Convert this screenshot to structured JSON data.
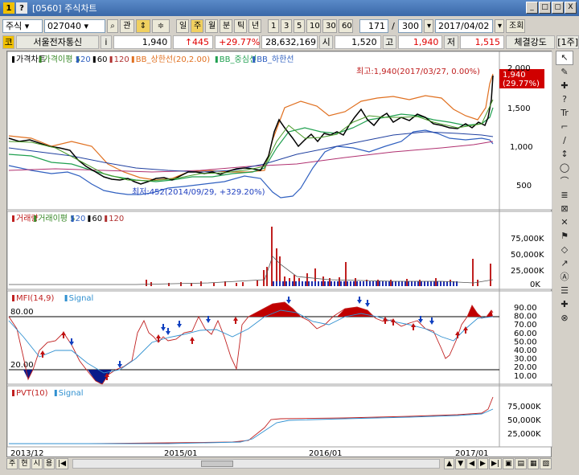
{
  "window": {
    "code_badge": "1",
    "help_badge": "?",
    "title": "[0560] 주식차트",
    "buttons": [
      "_",
      "□",
      "▢",
      "X"
    ]
  },
  "toolbar": {
    "market": "주식",
    "code": "027040",
    "btn_gwan": "관",
    "btn_updown": "≑",
    "periods": [
      "일",
      "주",
      "월",
      "분",
      "틱",
      "년"
    ],
    "active_period": 1,
    "intervals": [
      "1",
      "3",
      "5",
      "10",
      "30",
      "60"
    ],
    "count_value": "171",
    "slash": "/",
    "total_value": "300",
    "date": "2017/04/02",
    "btn_query": "조회"
  },
  "quote": {
    "badge": "코",
    "name": "서울전자통신",
    "info": "i",
    "price": "1,940",
    "change": "↑445",
    "rate": "+29.77%",
    "volume": "28,632,169",
    "open_label": "시",
    "open": "1,520",
    "high_label": "고",
    "high": "1,940",
    "low_label": "저",
    "low": "1,515",
    "strength_label": "체결강도",
    "view_btn": "[1주]"
  },
  "panels": {
    "price": {
      "legend": [
        "가격차트",
        "가격이평 5",
        "20",
        "60",
        "120",
        "BB_상한선(20,2.00)",
        "BB_중심선",
        "BB_하한선"
      ],
      "legend_colors": [
        "#000000",
        "#3a8a2a",
        "#3060c0",
        "#000000",
        "#b03030",
        "#e07020",
        "#20a050",
        "#3060c0"
      ],
      "axis": [
        "2,000",
        "1,500",
        "1,000",
        "500"
      ],
      "high_note": "최고:1,940(2017/03/27, 0.00%)",
      "low_note": "최저:452(2014/09/29, +329.20%)",
      "last_price": "1,940",
      "last_rate": "(29.77%)"
    },
    "volume": {
      "legend": [
        "거래량",
        "거래이평 5",
        "20",
        "60",
        "120"
      ],
      "legend_colors": [
        "#c02020",
        "#3a8a2a",
        "#3060c0",
        "#000000",
        "#b03030"
      ],
      "axis": [
        "75,000K",
        "50,000K",
        "25,000K",
        "0K"
      ]
    },
    "mfi": {
      "legend": [
        "MFI(14,9)",
        "Signal"
      ],
      "legend_colors": [
        "#c02020",
        "#3090d0"
      ],
      "axis": [
        "90.00",
        "80.00",
        "70.00",
        "60.00",
        "50.00",
        "40.00",
        "30.00",
        "20.00",
        "10.00"
      ],
      "upper": "80.00",
      "lower": "20.00"
    },
    "pvt": {
      "legend": [
        "PVT(10)",
        "Signal"
      ],
      "legend_colors": [
        "#c02020",
        "#3090d0"
      ],
      "axis": [
        "75,000K",
        "50,000K",
        "25,000K"
      ]
    }
  },
  "xaxis": [
    "2013/12",
    "2015/01",
    "2016/01",
    "2017/01"
  ],
  "bottom": {
    "buttons": [
      "주",
      "현",
      "시",
      "용"
    ]
  },
  "right_tools": [
    "↖",
    "✎",
    "✚",
    "?",
    "Tr",
    "⌐",
    "∕",
    "↕",
    "◯",
    "⌒",
    "≣",
    "⊠",
    "✕",
    "⚑",
    "◇",
    "↗",
    "Ⓐ",
    "☰",
    "✚",
    "⊗"
  ]
}
